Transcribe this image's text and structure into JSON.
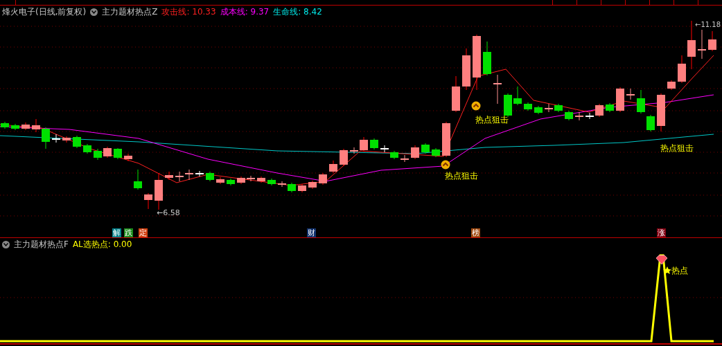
{
  "main_pane": {
    "stock_name": "烽火电子(日线,前复权)",
    "indicator": "主力题材热点Z",
    "values": [
      {
        "text": "攻击线: 10.33",
        "color": "#ff2020"
      },
      {
        "text": "成本线: 9.37",
        "color": "#ff00ff"
      },
      {
        "text": "生命线: 8.42",
        "color": "#00e8e8"
      }
    ],
    "high_label": "←11.18",
    "low_label": "←6.58",
    "signals": [
      "热点狙击",
      "热点狙击",
      "热点狙击"
    ]
  },
  "event_markers": [
    {
      "text": "解",
      "color": "#00808a"
    },
    {
      "text": "跌",
      "color": "#1a8a1a"
    },
    {
      "text": "定",
      "color": "#d04010"
    },
    {
      "text": "财",
      "color": "#10306a"
    },
    {
      "text": "榜",
      "color": "#a04a10"
    },
    {
      "text": "涨",
      "color": "#800010"
    }
  ],
  "sub_pane": {
    "indicator": "主力题材热点F",
    "values": [
      {
        "text": "AL选热点: 0.00",
        "color": "#ffff00"
      }
    ],
    "signal": "热点"
  }
}
